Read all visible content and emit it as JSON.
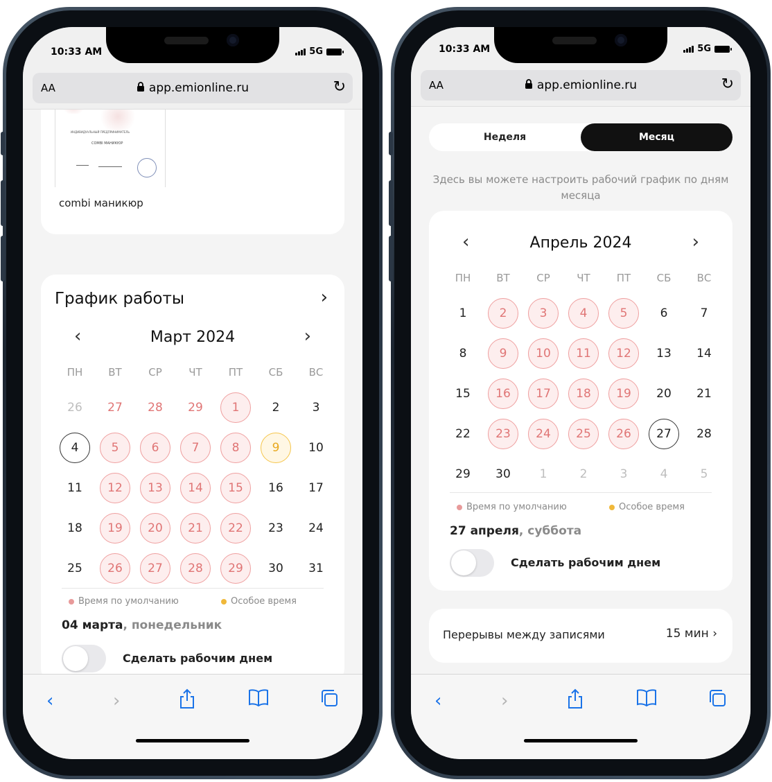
{
  "left_phone": {
    "status": {
      "time": "10:33 AM",
      "network": "5G"
    },
    "browser": {
      "aa": "AA",
      "url": "app.emionline.ru"
    },
    "doc_card": {
      "doc_line1": "ИНДИВИДУАЛЬНЫЙ ПРЕДПРИНИМАТЕЛЬ",
      "doc_line2": "COMBI МАНИКЮР",
      "doc_caption": "combi маникюр"
    },
    "schedule_card": {
      "title": "График работы",
      "month": "Март 2024",
      "weekdays": [
        "ПН",
        "ВТ",
        "СР",
        "ЧТ",
        "ПТ",
        "СБ",
        "ВС"
      ],
      "weeks": [
        [
          "26",
          "27",
          "28",
          "29",
          "1",
          "2",
          "3"
        ],
        [
          "4",
          "5",
          "6",
          "7",
          "8",
          "9",
          "10"
        ],
        [
          "11",
          "12",
          "13",
          "14",
          "15",
          "16",
          "17"
        ],
        [
          "18",
          "19",
          "20",
          "21",
          "22",
          "23",
          "24"
        ],
        [
          "25",
          "26",
          "27",
          "28",
          "29",
          "30",
          "31"
        ]
      ],
      "legend_default": "Время по умолчанию",
      "legend_special": "Особое время",
      "selected_date": "04 марта",
      "selected_weekday": ", понедельник",
      "toggle_label": "Сделать рабочим днем"
    }
  },
  "right_phone": {
    "status": {
      "time": "10:33 AM",
      "network": "5G"
    },
    "browser": {
      "aa": "AA",
      "url": "app.emionline.ru"
    },
    "tabs": {
      "week": "Неделя",
      "month": "Месяц"
    },
    "description": "Здесь вы можете настроить рабочий график по дням месяца",
    "calendar": {
      "month": "Апрель 2024",
      "weekdays": [
        "ПН",
        "ВТ",
        "СР",
        "ЧТ",
        "ПТ",
        "СБ",
        "ВС"
      ],
      "weeks": [
        [
          "1",
          "2",
          "3",
          "4",
          "5",
          "6",
          "7"
        ],
        [
          "8",
          "9",
          "10",
          "11",
          "12",
          "13",
          "14"
        ],
        [
          "15",
          "16",
          "17",
          "18",
          "19",
          "20",
          "21"
        ],
        [
          "22",
          "23",
          "24",
          "25",
          "26",
          "27",
          "28"
        ],
        [
          "29",
          "30",
          "1",
          "2",
          "3",
          "4",
          "5"
        ]
      ],
      "legend_default": "Время по умолчанию",
      "legend_special": "Особое время",
      "selected_date": "27 апреля",
      "selected_weekday": ", суббота",
      "toggle_label": "Сделать рабочим днем"
    },
    "breaks": {
      "label": "Перерывы между записями",
      "value": "15 мин"
    }
  },
  "colors": {
    "work_fill": "#fdeeee",
    "work_border": "#ef9f9f",
    "work_text": "#e07575",
    "special_border": "#f5c54a",
    "accent_blue": "#1a73e8",
    "tab_active": "#111111"
  },
  "icons": [
    "lock-icon",
    "reload-icon",
    "back-icon",
    "forward-icon",
    "share-icon",
    "bookmarks-icon",
    "tabs-icon",
    "chevron-left-icon",
    "chevron-right-icon"
  ]
}
